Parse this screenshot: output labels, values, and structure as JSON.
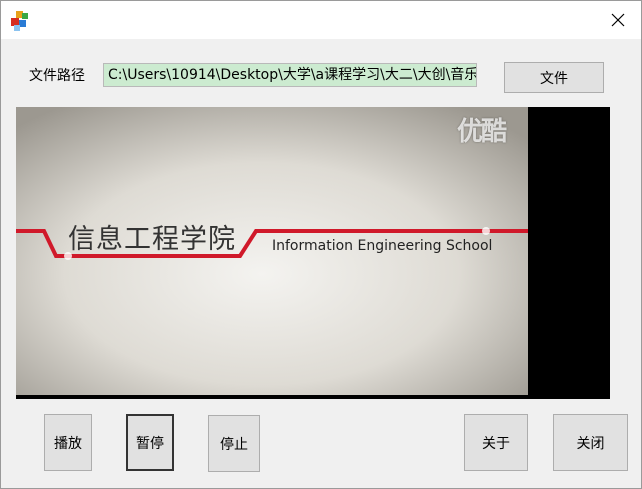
{
  "window": {
    "app_icon": "app-blocks-icon",
    "close_icon": "close-icon"
  },
  "file": {
    "label": "文件路径",
    "path": "C:\\Users\\10914\\Desktop\\大学\\a课程学习\\大二\\大创\\音乐",
    "browse_button": "文件"
  },
  "video": {
    "watermark": "优酷",
    "title_cn": "信息工程学院",
    "title_en": "Information Engineering School"
  },
  "controls": {
    "play": "播放",
    "pause": "暂停",
    "stop": "停止",
    "about": "关于",
    "close": "关闭"
  },
  "colors": {
    "path_field_bg": "#ccebd0",
    "stripe_red": "#d0192a",
    "video_bg": "#000000"
  }
}
